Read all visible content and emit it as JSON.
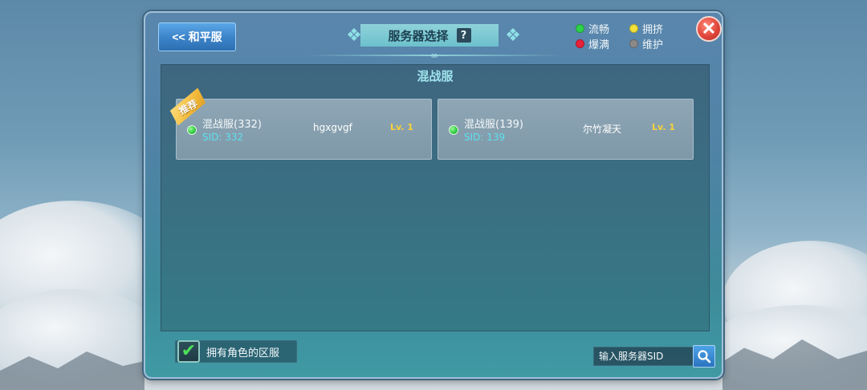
{
  "header": {
    "back_label": "<< 和平服",
    "title": "服务器选择",
    "help_label": "?"
  },
  "legend": [
    {
      "label": "流畅",
      "color": "#2ed24a"
    },
    {
      "label": "拥挤",
      "color": "#f2e23a"
    },
    {
      "label": "爆满",
      "color": "#e8213a"
    },
    {
      "label": "维护",
      "color": "#8a8a8a"
    }
  ],
  "close_icon": "close-x-icon",
  "section": {
    "title": "混战服"
  },
  "servers": [
    {
      "name": "混战服(332)",
      "sid": "SID: 332",
      "player": "hgxgvgf",
      "level": "Lv. 1",
      "badge": "推荐",
      "status": "流畅"
    },
    {
      "name": "混战服(139)",
      "sid": "SID: 139",
      "player": "尔竹凝天",
      "level": "Lv. 1",
      "badge": "",
      "status": "流畅"
    }
  ],
  "footer": {
    "own_roles_label": "拥有角色的区服",
    "own_roles_checked": true,
    "sid_input_placeholder": "输入服务器SID",
    "sid_input_value": ""
  }
}
